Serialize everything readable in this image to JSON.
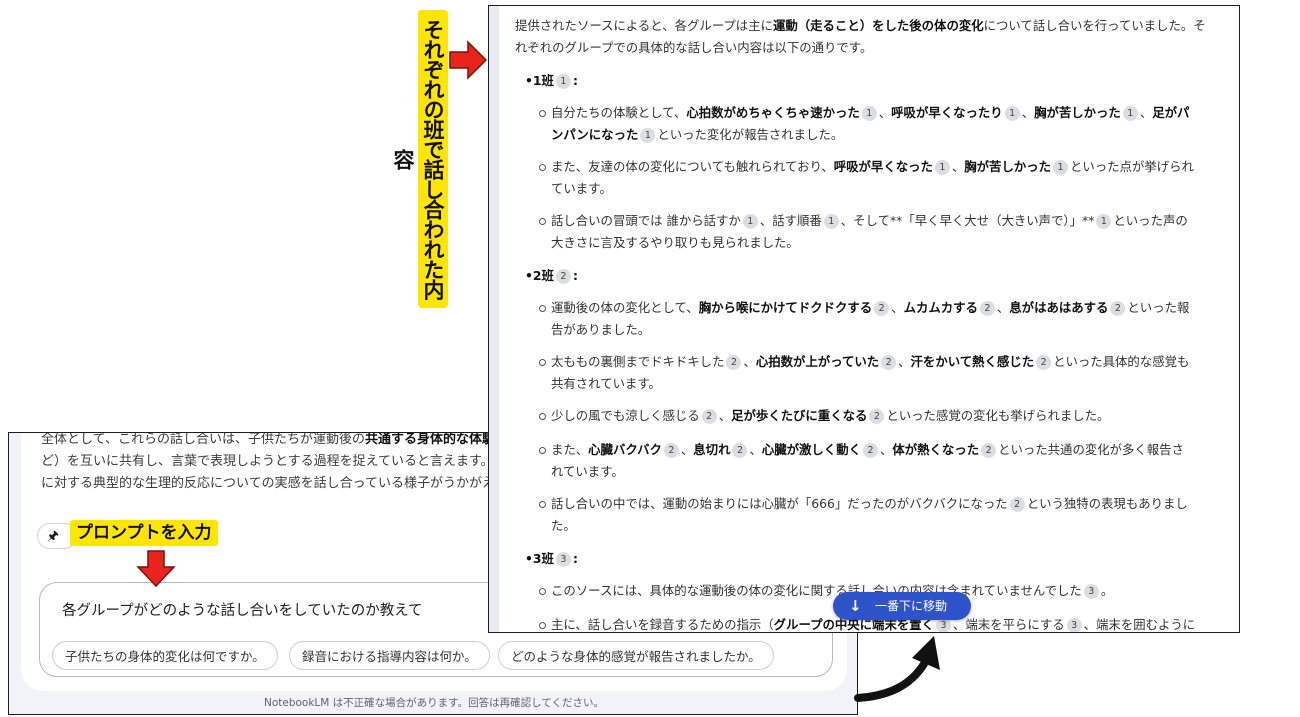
{
  "left": {
    "line1_pre": "全体として、これらの話し合いは、子供たちが運動後の",
    "line1_bold": "共通する身体的な体験",
    "line2": "ど）を互いに共有し、言葉で表現しようとする過程を捉えていると言えます。",
    "line3": "に対する典型的な生理的反応についての実感を話し合っている様子がうかがえ",
    "pin_icon": "pin-icon",
    "pin_glyph": "🖈",
    "input_value": "各グループがどのような話し合いをしていたのか教えて",
    "suggestions": [
      "子供たちの身体的変化は何ですか。",
      "録音における指導内容は何か。",
      "どのような身体的感覚が報告されましたか。"
    ],
    "disclaimer": "NotebookLM は不正確な場合があります。回答は再確認してください。"
  },
  "right": {
    "intro_l1_a": "提供されたソースによると、各グループは主に",
    "intro_l1_b": "運動（走ること）をした後の体の変化",
    "intro_l1_c": "について話し合いを行っていました。そ",
    "intro_l2": "れぞれのグループでの具体的な話し合い内容は以下の通りです。",
    "g1_head": "•1班",
    "g1_cite": "1",
    "g1_b1_l1": [
      "自分たちの体験として、",
      "心拍数がめちゃくちゃ速かった",
      "1",
      "、",
      "呼吸が早くなったり",
      "1",
      "、",
      "胸が苦しかった",
      "1",
      "、",
      "足がパ"
    ],
    "g1_b1_l2": [
      "ンパンになった",
      "1",
      "といった変化が報告されました。"
    ],
    "g1_b2_l1": [
      "また、友達の体の変化についても触れられており、",
      "呼吸が早くなった",
      "1",
      "、",
      "胸が苦しかった",
      "1",
      "といった点が挙げられ"
    ],
    "g1_b2_l2": "ています。",
    "g1_b3_l1": [
      "話し合いの冒頭では",
      "誰から話すか",
      "1",
      "、話す順番",
      "1",
      "、そして**「早く早く大せ（大きい声で）」**",
      "1",
      "といった声の"
    ],
    "g1_b3_l2": "大きさに言及するやり取りも見られました。",
    "g2_head": "•2班",
    "g2_cite": "2",
    "g2_b1_l1": [
      "運動後の体の変化として、",
      "胸から喉にかけてドクドクする",
      "2",
      "、",
      "ムカムカする",
      "2",
      "、",
      "息がはあはあする",
      "2",
      "といった報"
    ],
    "g2_b1_l2": "告がありました。",
    "g2_b2_l1": [
      "太ももの裏側までドキドキした",
      "2",
      "、",
      "心拍数が上がっていた",
      "2",
      "、",
      "汗をかいて熱く感じた",
      "2",
      "といった具体的な感覚も"
    ],
    "g2_b2_l2": "共有されています。",
    "g2_b3_l1": [
      "少しの風でも涼しく感じる",
      "2",
      "、",
      "足が歩くたびに重くなる",
      "2",
      "といった感覚の変化も挙げられました。"
    ],
    "g2_b4_l1": [
      "また、",
      "心臓バクバク",
      "2",
      "、",
      "息切れ",
      "2",
      "、",
      "心臓が激しく動く",
      "2",
      "、",
      "体が熱くなった",
      "2",
      "といった共通の変化が多く報告さ"
    ],
    "g2_b4_l2": "れています。",
    "g2_b5_l1": [
      "話し合いの中では、運動の始まりには心臓が「666」だったのがバクバクになった",
      "2",
      "という独特の表現もありまし"
    ],
    "g2_b5_l2": "た。",
    "g3_head": "•3班",
    "g3_cite": "3",
    "g3_b1_l1": [
      "このソースには、具体的な運動後の体の変化に関する話し合いの内容は含まれていませんでした",
      "3",
      "。"
    ],
    "g3_b2_l1": [
      "主に、話し合いを録音するための指示（",
      "グループの中央に端末を置く",
      "3",
      "、端末を平らにする",
      "3",
      "、端末を囲むように"
    ],
    "scroll_button": "一番下に移動",
    "scroll_arrow": "↓"
  },
  "annotations": {
    "vertical_label": "それぞれの班で話し合われた内容",
    "prompt_label": "プロンプトを入力"
  },
  "colors": {
    "highlight": "#ffe600",
    "arrow_red": "#e8241d",
    "button_blue": "#2e52c9"
  }
}
